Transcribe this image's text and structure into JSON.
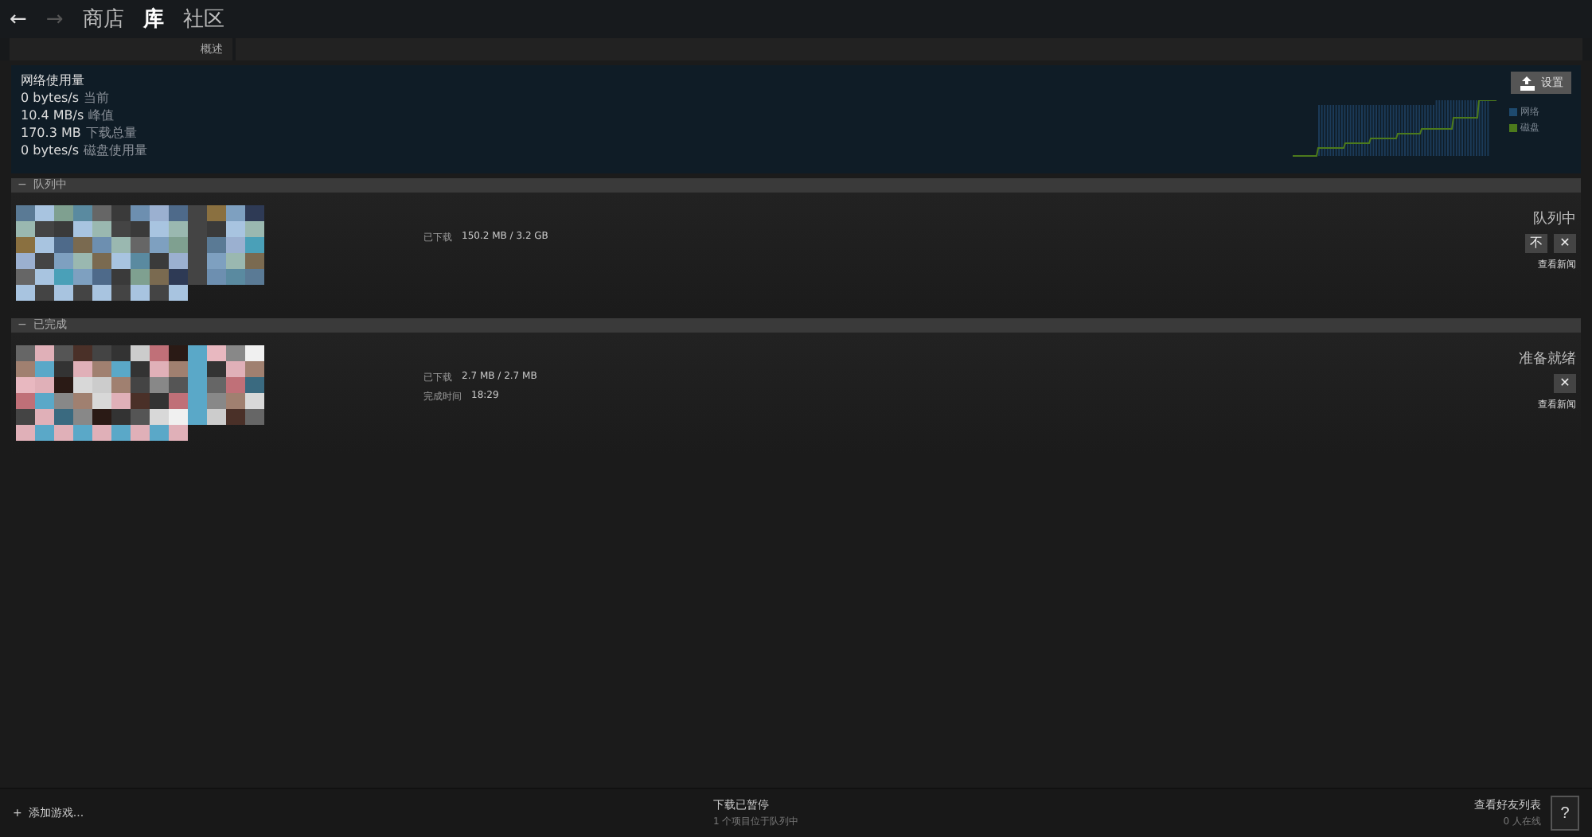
{
  "nav": {
    "back": "←",
    "forward": "→",
    "items": [
      {
        "label": "商店",
        "selected": false
      },
      {
        "label": "库",
        "selected": true
      },
      {
        "label": "社区",
        "selected": false
      }
    ]
  },
  "subnav": {
    "label": "概述"
  },
  "stats": {
    "title": "网络使用量",
    "rows": [
      {
        "amount": "0 bytes/s",
        "desc": "当前"
      },
      {
        "amount": "10.4 MB/s",
        "desc": "峰值"
      },
      {
        "amount": "170.3 MB",
        "desc": "下载总量"
      },
      {
        "amount": "0 bytes/s",
        "desc": "磁盘使用量"
      }
    ],
    "settings_button": "设置",
    "legend": [
      {
        "label": "网络",
        "color": "#1e4a6e"
      },
      {
        "label": "磁盘",
        "color": "#4c7a1c"
      }
    ]
  },
  "sections": [
    {
      "title": "队列中",
      "expand_mark": "−",
      "items": [
        {
          "kind": "queued",
          "fields": [
            {
              "label": "已下载",
              "value": "150.2 MB / 3.2 GB"
            }
          ],
          "status": "队列中",
          "buttons": [
            "不",
            "✕"
          ],
          "news_link": "查看新闻"
        }
      ]
    },
    {
      "title": "已完成",
      "expand_mark": "−",
      "items": [
        {
          "kind": "done",
          "fields": [
            {
              "label": "已下载",
              "value": "2.7 MB / 2.7 MB"
            },
            {
              "label": "完成时间",
              "value": "18:29"
            }
          ],
          "status": "准备就绪",
          "buttons": [
            "✕"
          ],
          "news_link": "查看新闻"
        }
      ]
    }
  ],
  "footer": {
    "add_icon": "+",
    "add_game": "添加游戏...",
    "status": "下载已暂停",
    "sub_status": "1 个项目位于队列中",
    "friends": "查看好友列表",
    "online": "0 人在线",
    "help": "?"
  }
}
